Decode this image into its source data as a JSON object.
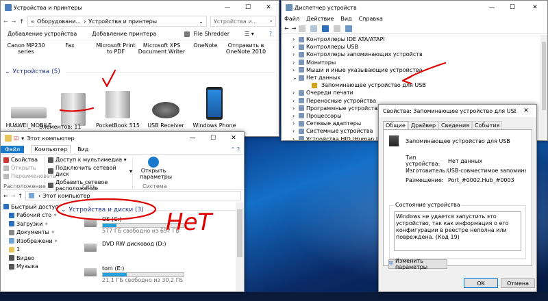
{
  "devices": {
    "title": "Устройства и принтеры",
    "path": [
      "Оборудовани...",
      "Устройства и принтеры"
    ],
    "search": "Устройства и...",
    "toolbar": {
      "add_device": "Добавление устройства",
      "add_printer": "Добавление принтера",
      "shredder": "File Shredder"
    },
    "printers": [
      "Canon MP230 series",
      "Fax",
      "Microsoft Print to PDF",
      "Microsoft XPS Document Writer",
      "OneNote",
      "Отправить в OneNote 2010"
    ],
    "group": "Устройства (5)",
    "items": [
      "HUAWEI_MOBILE",
      "",
      "PocketBook 515",
      "USB Receiver",
      "Windows Phone"
    ],
    "count": "Элементов: 11"
  },
  "dm": {
    "title": "Диспетчер устройств",
    "menu": [
      "Файл",
      "Действие",
      "Вид",
      "Справка"
    ],
    "tree": [
      {
        "label": "Контроллеры IDE ATA/ATAPI",
        "exp": "›"
      },
      {
        "label": "Контроллеры USB",
        "exp": "›"
      },
      {
        "label": "Контроллеры запоминающих устройств",
        "exp": "›"
      },
      {
        "label": "Мониторы",
        "exp": "›"
      },
      {
        "label": "Мыши и иные указывающие устройства",
        "exp": "›"
      },
      {
        "label": "Нет данных",
        "exp": "⌄"
      },
      {
        "label": "Запоминающее устройство для USB",
        "exp": ""
      },
      {
        "label": "Очереди печати",
        "exp": "›"
      },
      {
        "label": "Переносные устройства",
        "exp": "›"
      },
      {
        "label": "Программные устройства",
        "exp": "›"
      },
      {
        "label": "Процессоры",
        "exp": "›"
      },
      {
        "label": "Сетевые адаптеры",
        "exp": "›"
      },
      {
        "label": "Системные устройства",
        "exp": "›"
      },
      {
        "label": "Устройства HID (Human Interface",
        "exp": "›"
      }
    ]
  },
  "props": {
    "title": "Свойства: Запоминающее устройство для USB",
    "tabs": [
      "Общие",
      "Драйвер",
      "Сведения",
      "События"
    ],
    "name": "Запоминающее устройство для USB",
    "fields": [
      {
        "k": "Тип устройства:",
        "v": "Нет данных"
      },
      {
        "k": "Изготовитель:",
        "v": "USB-совместимое запоминающее устройс"
      },
      {
        "k": "Размещение:",
        "v": "Port_#0002.Hub_#0003"
      }
    ],
    "status_label": "Состояние устройства",
    "status": "Windows не удается запустить это устройство, так как информация о его конфигурации в реестре неполна или повреждена. (Код 19)",
    "change": "Изменить параметры",
    "ok": "OK",
    "cancel": "Отмена"
  },
  "explorer": {
    "title": "Этот компьютер",
    "tabs": [
      "Файл",
      "Компьютер",
      "Вид"
    ],
    "ribbon": {
      "props": "Свойства",
      "open": "Открыть",
      "rename": "Переименовать",
      "group1": "Расположение",
      "media": "Доступ к мультимедиа",
      "netdrive": "Подключить сетевой диск",
      "netloc": "Добавить сетевое расположение",
      "group2": "Сеть",
      "settings": "Открыть параметры",
      "group3": "Система"
    },
    "path": "Этот компьютер",
    "nav": [
      "Быстрый доступ",
      "Рабочий сто",
      "Загрузки",
      "Документы",
      "Изображени",
      "1",
      "Видео",
      "Музыка"
    ],
    "section": "Устройства и диски (3)",
    "drives": [
      {
        "name": "OS (C:)",
        "free": "577 ГБ свободно из 697 ГБ",
        "fill": 0.17
      },
      {
        "name": "DVD RW дисковод (D:)",
        "free": "",
        "fill": 0
      },
      {
        "name": "tom (E:)",
        "free": "21,1 ГБ свободно из 30,2 ГБ",
        "fill": 0.3
      }
    ]
  },
  "annotation": "НеТ"
}
